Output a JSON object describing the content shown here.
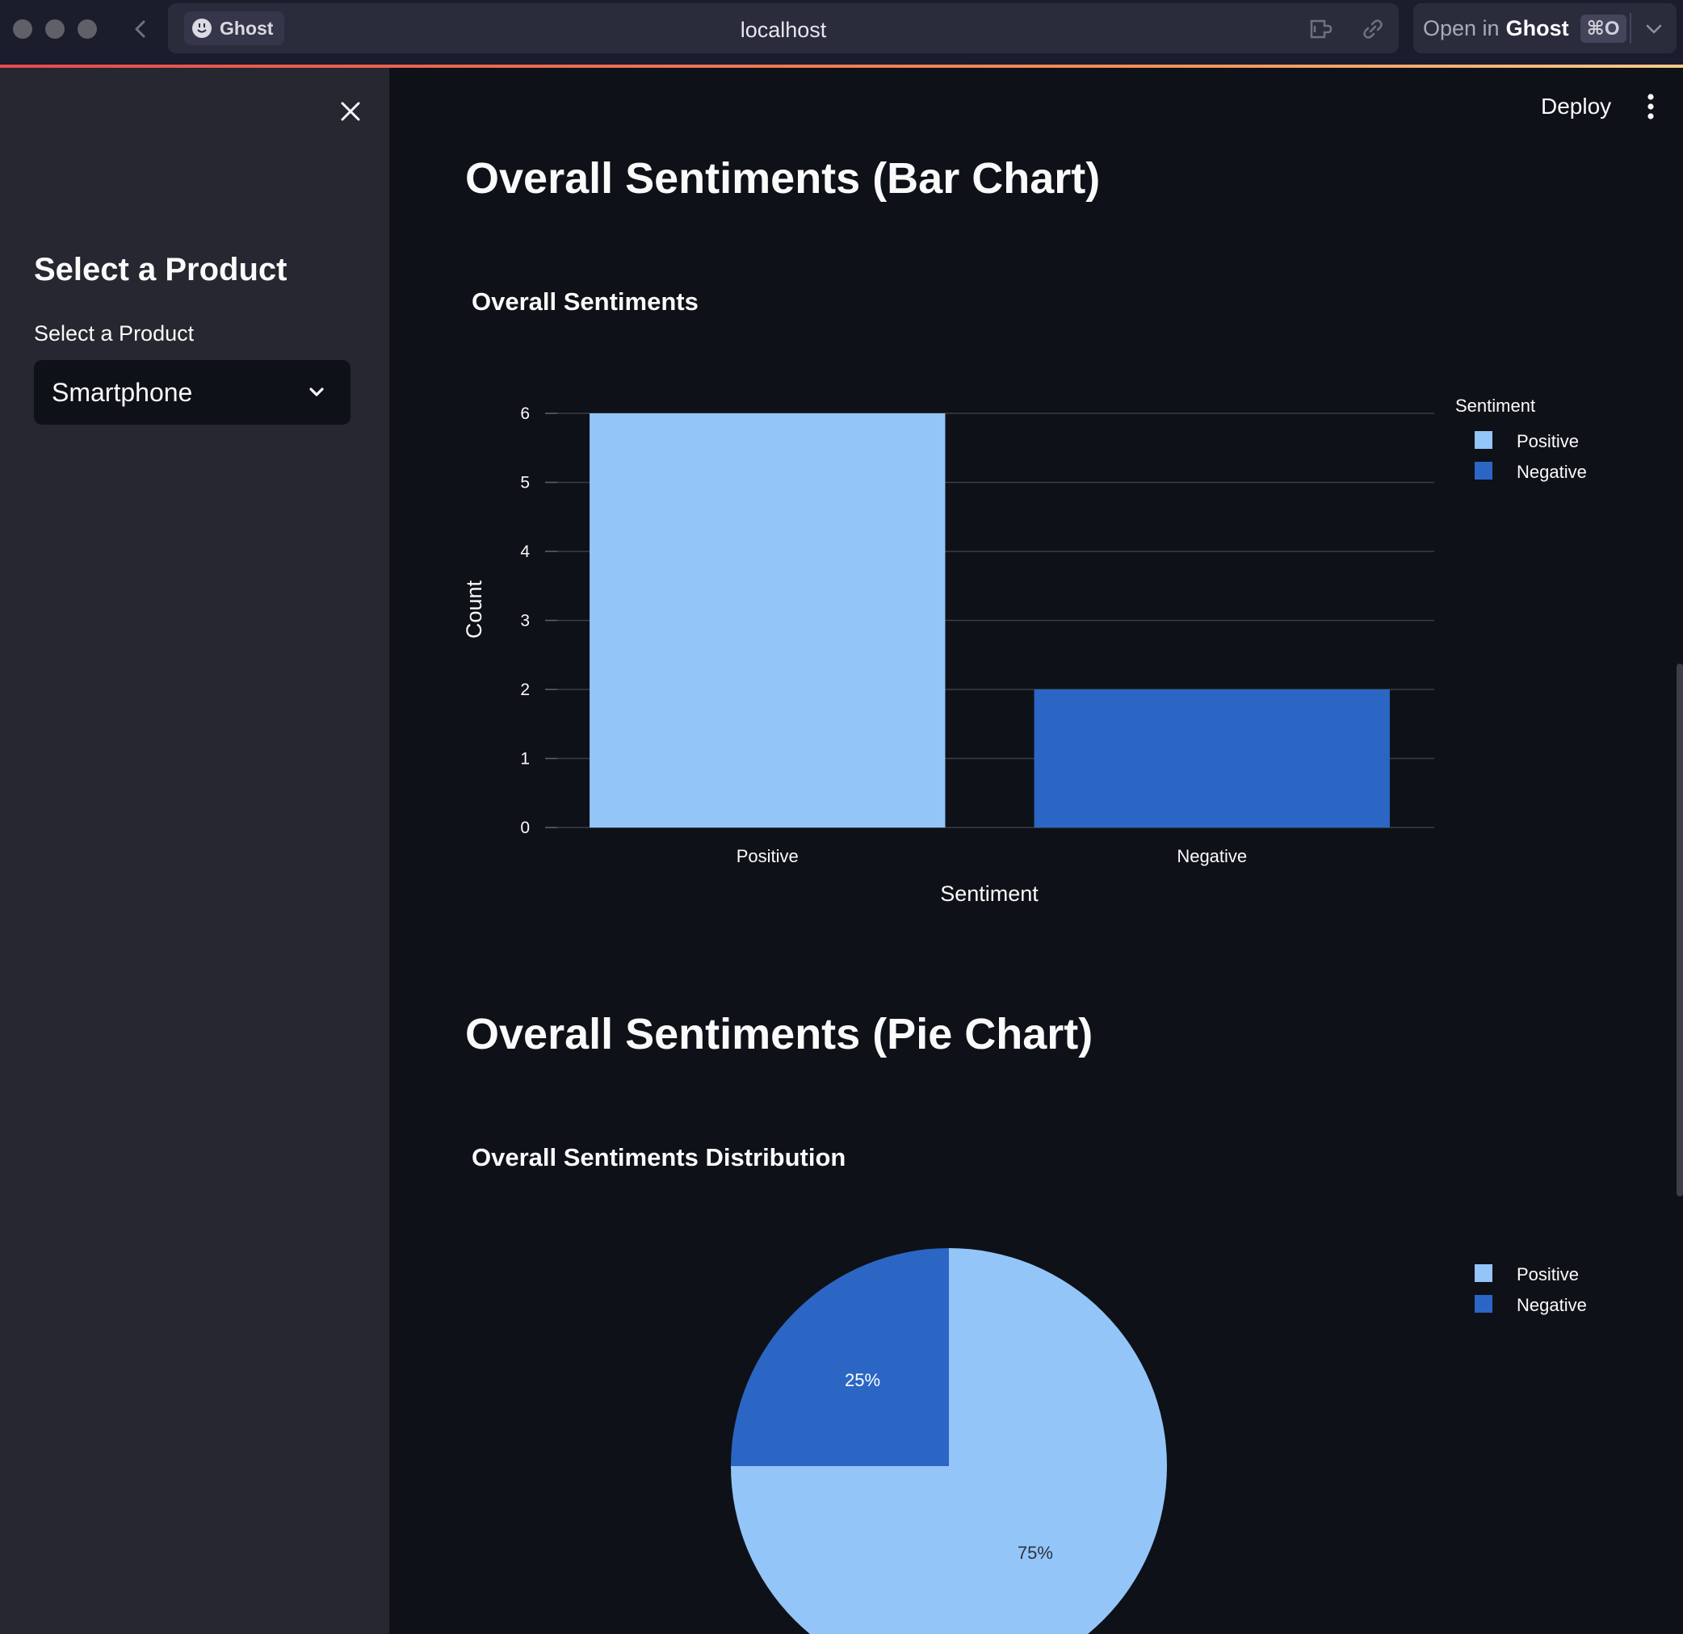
{
  "browser": {
    "app_name": "Ghost",
    "url": "localhost",
    "open_in_prefix": "Open in",
    "open_in_app": "Ghost",
    "shortcut": "⌘O"
  },
  "sidebar": {
    "heading": "Select a Product",
    "select_label": "Select a Product",
    "selected_value": "Smartphone"
  },
  "header": {
    "deploy_label": "Deploy"
  },
  "sections": {
    "bar_heading": "Overall Sentiments (Bar Chart)",
    "pie_heading": "Overall Sentiments (Pie Chart)"
  },
  "colors": {
    "positive": "#93c5f8",
    "negative": "#2b66c4",
    "background": "#0e1117",
    "sidebar": "#262730"
  },
  "chart_data": [
    {
      "type": "bar",
      "title": "Overall Sentiments",
      "xlabel": "Sentiment",
      "ylabel": "Count",
      "categories": [
        "Positive",
        "Negative"
      ],
      "values": [
        6,
        2
      ],
      "ylim": [
        0,
        6
      ],
      "yticks": [
        "0",
        "1",
        "2",
        "3",
        "4",
        "5",
        "6"
      ],
      "grid": true,
      "legend": {
        "title": "Sentiment",
        "entries": [
          "Positive",
          "Negative"
        ],
        "placement": "top-right"
      }
    },
    {
      "type": "pie",
      "title": "Overall Sentiments Distribution",
      "labels": [
        "Positive",
        "Negative"
      ],
      "values": [
        6,
        2
      ],
      "slice_labels": [
        "75%",
        "25%"
      ],
      "legend": {
        "entries": [
          "Positive",
          "Negative"
        ],
        "placement": "top-right"
      }
    }
  ]
}
